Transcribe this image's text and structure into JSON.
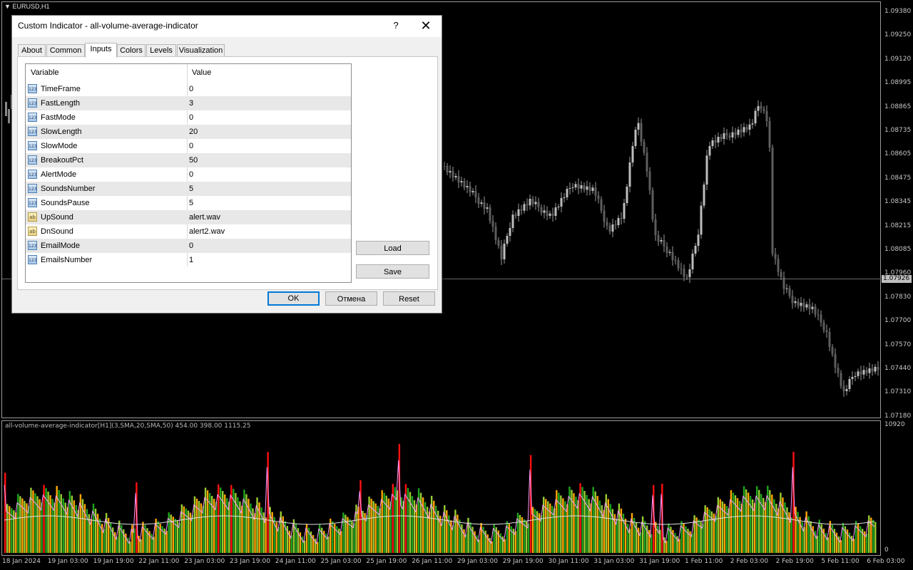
{
  "main_chart": {
    "symbol_label": "EURUSD,H1",
    "price_levels": [
      "1.09380",
      "1.09250",
      "1.09120",
      "1.08995",
      "1.08865",
      "1.08735",
      "1.08605",
      "1.08475",
      "1.08345",
      "1.08215",
      "1.08085",
      "1.07960",
      "1.07830",
      "1.07700",
      "1.07570",
      "1.07440",
      "1.07310",
      "1.07180"
    ],
    "current_price": "1.07926"
  },
  "indicator": {
    "label": "all-volume-average-indicator[H1](3,SMA,20,SMA,50) 454.00 398.00 1115.25",
    "scale_max": "10920",
    "scale_min": "0",
    "colors": {
      "green": "#1fa51f",
      "lightgreen": "#9acd32",
      "orange": "#ffa500",
      "red": "#ff1010",
      "fast_line": "#ff9bff",
      "slow_line": "#e0e0e0"
    }
  },
  "time_axis": [
    "18 Jan 2024",
    "19 Jan 03:00",
    "19 Jan 19:00",
    "22 Jan 11:00",
    "23 Jan 03:00",
    "23 Jan 19:00",
    "24 Jan 11:00",
    "25 Jan 03:00",
    "25 Jan 19:00",
    "26 Jan 11:00",
    "29 Jan 03:00",
    "29 Jan 19:00",
    "30 Jan 11:00",
    "31 Jan 03:00",
    "31 Jan 19:00",
    "1 Feb 11:00",
    "2 Feb 03:00",
    "2 Feb 19:00",
    "5 Feb 11:00",
    "6 Feb 03:00"
  ],
  "dialog": {
    "title": "Custom Indicator - all-volume-average-indicator",
    "help_label": "?",
    "close_label": "✕",
    "tabs": [
      "About",
      "Common",
      "Inputs",
      "Colors",
      "Levels",
      "Visualization"
    ],
    "active_tab": "Inputs",
    "table": {
      "headers": [
        "Variable",
        "Value"
      ],
      "rows": [
        {
          "icon": "123",
          "variable": "TimeFrame",
          "value": "0"
        },
        {
          "icon": "123",
          "variable": "FastLength",
          "value": "3"
        },
        {
          "icon": "123",
          "variable": "FastMode",
          "value": "0"
        },
        {
          "icon": "123",
          "variable": "SlowLength",
          "value": "20"
        },
        {
          "icon": "123",
          "variable": "SlowMode",
          "value": "0"
        },
        {
          "icon": "123",
          "variable": "BreakoutPct",
          "value": "50"
        },
        {
          "icon": "123",
          "variable": "AlertMode",
          "value": "0"
        },
        {
          "icon": "123",
          "variable": "SoundsNumber",
          "value": "5"
        },
        {
          "icon": "123",
          "variable": "SoundsPause",
          "value": "5"
        },
        {
          "icon": "ab",
          "variable": "UpSound",
          "value": "alert.wav"
        },
        {
          "icon": "ab",
          "variable": "DnSound",
          "value": "alert2.wav"
        },
        {
          "icon": "123",
          "variable": "EmailMode",
          "value": "0"
        },
        {
          "icon": "123",
          "variable": "EmailsNumber",
          "value": "1"
        }
      ]
    },
    "buttons": {
      "load": "Load",
      "save": "Save",
      "ok": "OK",
      "cancel": "Отмена",
      "reset": "Reset"
    }
  }
}
